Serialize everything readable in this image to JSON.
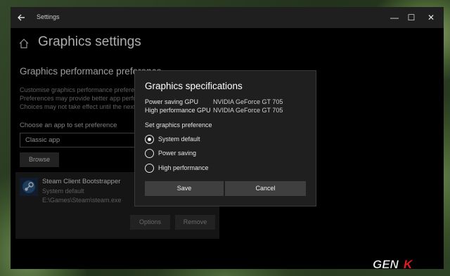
{
  "window": {
    "title": "Settings",
    "controls": {
      "minimize": "—",
      "maximize": "☐",
      "close": "✕"
    }
  },
  "page": {
    "title": "Graphics settings",
    "section_title": "Graphics performance preference",
    "description_lines": [
      "Customise graphics performance preferen",
      "Preferences may provide better app perfo",
      "Choices may not take effect until the next"
    ],
    "choose_label": "Choose an app to set preference",
    "app_type_value": "Classic app",
    "browse_label": "Browse"
  },
  "app_entry": {
    "name": "Steam Client Bootstrapper",
    "preference": "System default",
    "path": "E:\\Games\\Steam\\steam.exe",
    "options_label": "Options",
    "remove_label": "Remove"
  },
  "dialog": {
    "title": "Graphics specifications",
    "gpus": [
      {
        "label": "Power saving GPU",
        "value": "NVIDIA GeForce GT 705"
      },
      {
        "label": "High performance GPU",
        "value": "NVIDIA GeForce GT 705"
      }
    ],
    "preference_label": "Set graphics preference",
    "options": [
      {
        "label": "System default",
        "selected": true
      },
      {
        "label": "Power saving",
        "selected": false
      },
      {
        "label": "High performance",
        "selected": false
      }
    ],
    "save_label": "Save",
    "cancel_label": "Cancel"
  },
  "watermark": {
    "text": "GENK"
  },
  "colors": {
    "window_bg": "#000000",
    "titlebar_bg": "#1f1f1f",
    "dialog_bg": "#1f1f1f",
    "button_bg": "#3f3f3f",
    "watermark_red": "#e21b23"
  }
}
